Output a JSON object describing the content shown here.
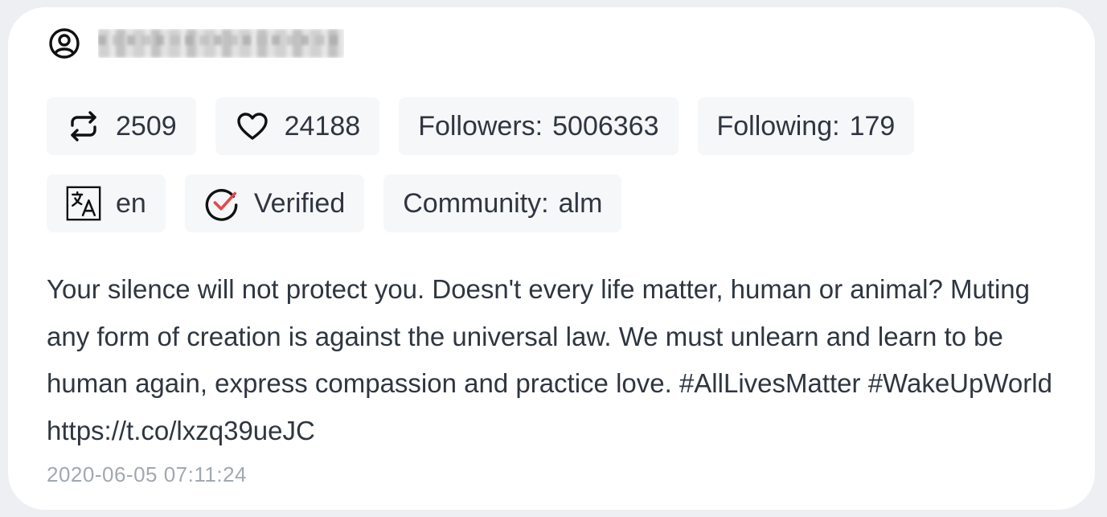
{
  "user": {
    "name": "username",
    "avatar_icon": "user-circle-icon"
  },
  "stats": {
    "retweets": {
      "icon": "retweet-icon",
      "value": "2509"
    },
    "likes": {
      "icon": "heart-icon",
      "value": "24188"
    },
    "followers": {
      "label": "Followers:",
      "value": "5006363"
    },
    "following": {
      "label": "Following:",
      "value": "179"
    }
  },
  "meta": {
    "language": {
      "icon": "translate-icon",
      "value": "en"
    },
    "verified": {
      "icon": "verified-check-icon",
      "label": "Verified"
    },
    "community": {
      "label": "Community:",
      "value": "alm"
    }
  },
  "tweet": {
    "text": "Your silence will not protect you. Doesn't every life matter, human or animal? Muting any form of creation is against the universal law. We must unlearn and learn to be human again, express compassion and practice love. #AllLivesMatter #WakeUpWorld https://t.co/lxzq39ueJC",
    "timestamp": "2020-06-05 07:11:24"
  },
  "colors": {
    "background": "#eeeff2",
    "card": "#ffffff",
    "chip": "#f6f7f9",
    "text": "#2f3640",
    "muted": "#a2a8b0",
    "check_accent": "#e5484d"
  }
}
